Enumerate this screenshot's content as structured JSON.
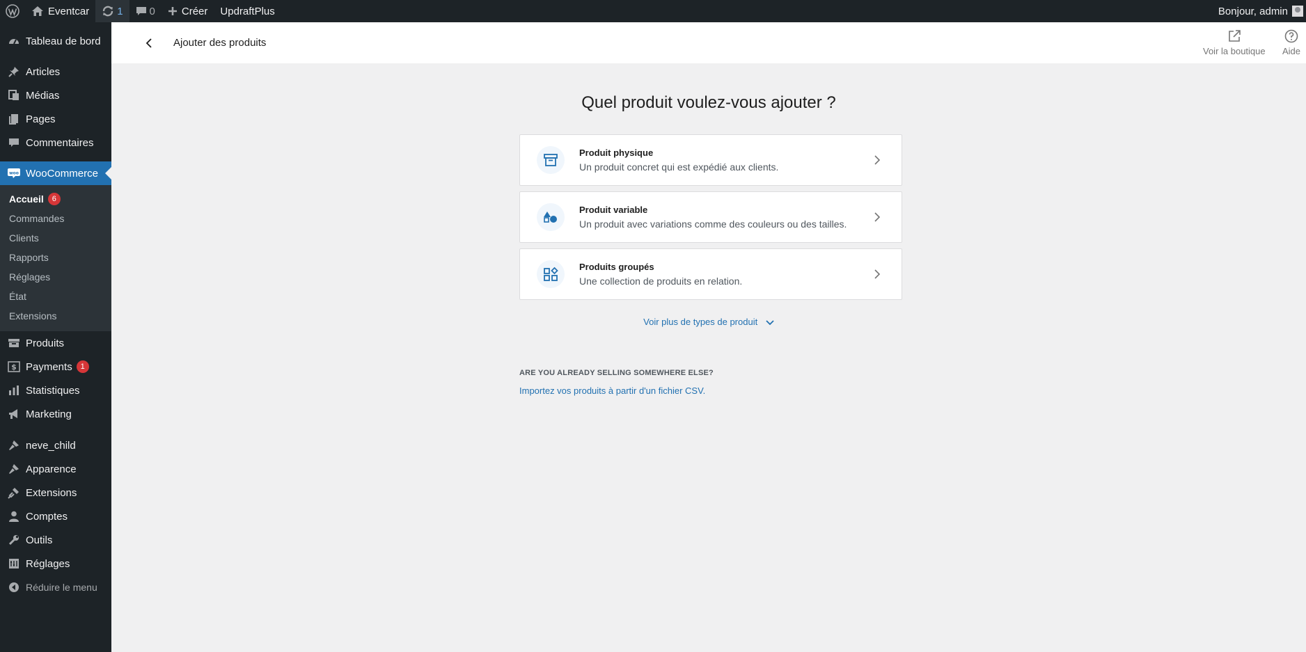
{
  "adminbar": {
    "site_name": "Eventcar",
    "updates_count": "1",
    "comments_count": "0",
    "create_label": "Créer",
    "plugin_label": "UpdraftPlus",
    "greeting": "Bonjour, admin"
  },
  "sidebar": {
    "top_items": [
      {
        "label": "Tableau de bord",
        "icon": "dashboard-icon"
      },
      {
        "label": "Articles",
        "icon": "pin-icon"
      },
      {
        "label": "Médias",
        "icon": "media-icon"
      },
      {
        "label": "Pages",
        "icon": "pages-icon"
      },
      {
        "label": "Commentaires",
        "icon": "comment-icon"
      }
    ],
    "woocommerce": {
      "label": "WooCommerce",
      "submenu": [
        {
          "label": "Accueil",
          "badge": "6"
        },
        {
          "label": "Commandes"
        },
        {
          "label": "Clients"
        },
        {
          "label": "Rapports"
        },
        {
          "label": "Réglages"
        },
        {
          "label": "État"
        },
        {
          "label": "Extensions"
        }
      ]
    },
    "mid_items": [
      {
        "label": "Produits",
        "icon": "archive-icon"
      },
      {
        "label": "Payments",
        "icon": "dollar-icon",
        "badge": "1"
      },
      {
        "label": "Statistiques",
        "icon": "chart-bar-icon"
      },
      {
        "label": "Marketing",
        "icon": "megaphone-icon"
      }
    ],
    "bottom_items": [
      {
        "label": "neve_child",
        "icon": "brush-icon"
      },
      {
        "label": "Apparence",
        "icon": "brush-icon"
      },
      {
        "label": "Extensions",
        "icon": "plugin-icon"
      },
      {
        "label": "Comptes",
        "icon": "user-icon"
      },
      {
        "label": "Outils",
        "icon": "wrench-icon"
      },
      {
        "label": "Réglages",
        "icon": "settings-icon"
      }
    ],
    "collapse_label": "Réduire le menu"
  },
  "header": {
    "title": "Ajouter des produits",
    "view_store": "Voir la boutique",
    "help": "Aide"
  },
  "main": {
    "question": "Quel produit voulez-vous ajouter ?",
    "cards": [
      {
        "title": "Produit physique",
        "desc": "Un produit concret qui est expédié aux clients.",
        "icon": "box-icon"
      },
      {
        "title": "Produit variable",
        "desc": "Un produit avec variations comme des couleurs ou des tailles.",
        "icon": "shapes-icon"
      },
      {
        "title": "Produits groupés",
        "desc": "Une collection de produits en relation.",
        "icon": "grid-icon"
      }
    ],
    "more_types": "Voir plus de types de produit",
    "csv_heading": "ARE YOU ALREADY SELLING SOMEWHERE ELSE?",
    "csv_link": "Importez vos produits à partir d'un fichier CSV."
  },
  "colors": {
    "sidebar_bg": "#1d2327",
    "accent": "#2271b1",
    "badge": "#d63638"
  }
}
